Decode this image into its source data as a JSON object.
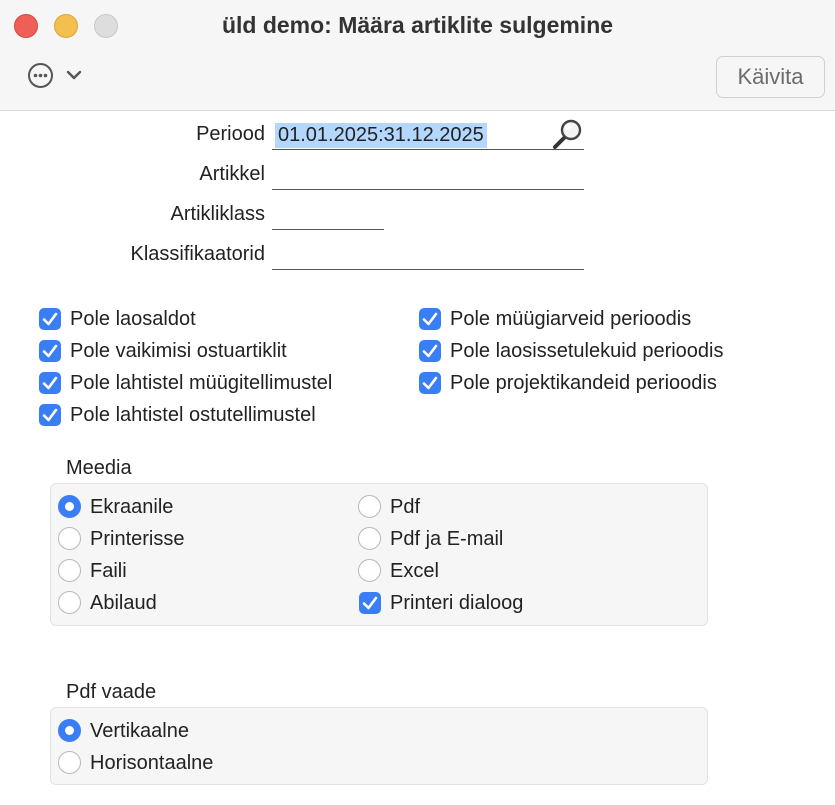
{
  "window": {
    "title": "üld demo: Määra artiklite sulgemine"
  },
  "toolbar": {
    "more_icon": "ellipsis-circle-icon",
    "chevron_icon": "chevron-down-icon",
    "run_label": "Käivita"
  },
  "form": {
    "period_label": "Periood",
    "period_value": "01.01.2025:31.12.2025",
    "article_label": "Artikkel",
    "article_value": "",
    "article_class_label": "Artikliklass",
    "article_class_value": "",
    "classifiers_label": "Klassifikaatorid",
    "classifiers_value": ""
  },
  "options": [
    {
      "label": "Pole laosaldot",
      "checked": true
    },
    {
      "label": "Pole vaikimisi ostuartiklit",
      "checked": true
    },
    {
      "label": "Pole lahtistel müügitellimustel",
      "checked": true
    },
    {
      "label": "Pole lahtistel ostutellimustel",
      "checked": true
    },
    {
      "label": "Pole müügiarveid perioodis",
      "checked": true
    },
    {
      "label": "Pole laosissetulekuid perioodis",
      "checked": true
    },
    {
      "label": "Pole projektikandeid perioodis",
      "checked": true
    }
  ],
  "media": {
    "title": "Meedia",
    "radios": [
      {
        "label": "Ekraanile",
        "selected": true
      },
      {
        "label": "Printerisse",
        "selected": false
      },
      {
        "label": "Faili",
        "selected": false
      },
      {
        "label": "Abilaud",
        "selected": false
      },
      {
        "label": "Pdf",
        "selected": false
      },
      {
        "label": "Pdf ja E-mail",
        "selected": false
      },
      {
        "label": "Excel",
        "selected": false
      }
    ],
    "printer_dialog": {
      "label": "Printeri dialoog",
      "checked": true
    }
  },
  "pdf_view": {
    "title": "Pdf vaade",
    "radios": [
      {
        "label": "Vertikaalne",
        "selected": true
      },
      {
        "label": "Horisontaalne",
        "selected": false
      }
    ]
  },
  "colors": {
    "accent": "#3a7ef6",
    "selection": "#b3d7ff",
    "close": "#ee5f58",
    "minimize": "#f5bf4f",
    "zoom_disabled": "#dddddd"
  }
}
